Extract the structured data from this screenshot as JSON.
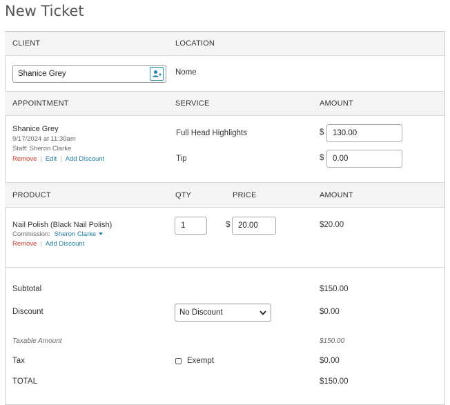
{
  "page": {
    "title": "New Ticket"
  },
  "client_section": {
    "client_header": "CLIENT",
    "location_header": "LOCATION",
    "client_value": "Shanice Grey",
    "location_value": "Nome"
  },
  "appointment_section": {
    "headers": {
      "appointment": "APPOINTMENT",
      "service": "SERVICE",
      "amount": "AMOUNT"
    },
    "client_name": "Shanice Grey",
    "datetime": "9/17/2024 at 11:30am",
    "staff": "Staff: Sheron Clarke",
    "actions": {
      "remove": "Remove",
      "edit": "Edit",
      "add_discount": "Add Discount"
    },
    "service_name": "Full Head Highlights",
    "service_amount": "130.00",
    "tip_label": "Tip",
    "tip_amount": "0.00",
    "currency": "$"
  },
  "product_section": {
    "headers": {
      "product": "PRODUCT",
      "qty": "QTY",
      "price": "PRICE",
      "amount": "AMOUNT"
    },
    "product_name": "Nail Polish (Black Nail Polish)",
    "commission_label": "Commission:",
    "commission_staff": "Sheron Clarke",
    "actions": {
      "remove": "Remove",
      "add_discount": "Add Discount"
    },
    "qty": "1",
    "price": "20.00",
    "amount": "$20.00",
    "currency": "$"
  },
  "totals": {
    "subtotal_label": "Subtotal",
    "subtotal_value": "$150.00",
    "discount_label": "Discount",
    "discount_select": "No Discount",
    "discount_value": "$0.00",
    "taxable_label": "Taxable Amount",
    "taxable_value": "$150.00",
    "tax_label": "Tax",
    "exempt_label": "Exempt",
    "exempt_checked": false,
    "tax_value": "$0.00",
    "total_label": "TOTAL",
    "total_value": "$150.00"
  },
  "colors": {
    "link": "#1d7ea0",
    "remove": "#cc3a2a",
    "header_band": "#f4f4f4",
    "border": "#cccccc"
  },
  "icons": {
    "add_client": "person-plus-icon",
    "commission_dropdown": "caret-down-icon",
    "select_dropdown": "chevron-down-icon"
  }
}
